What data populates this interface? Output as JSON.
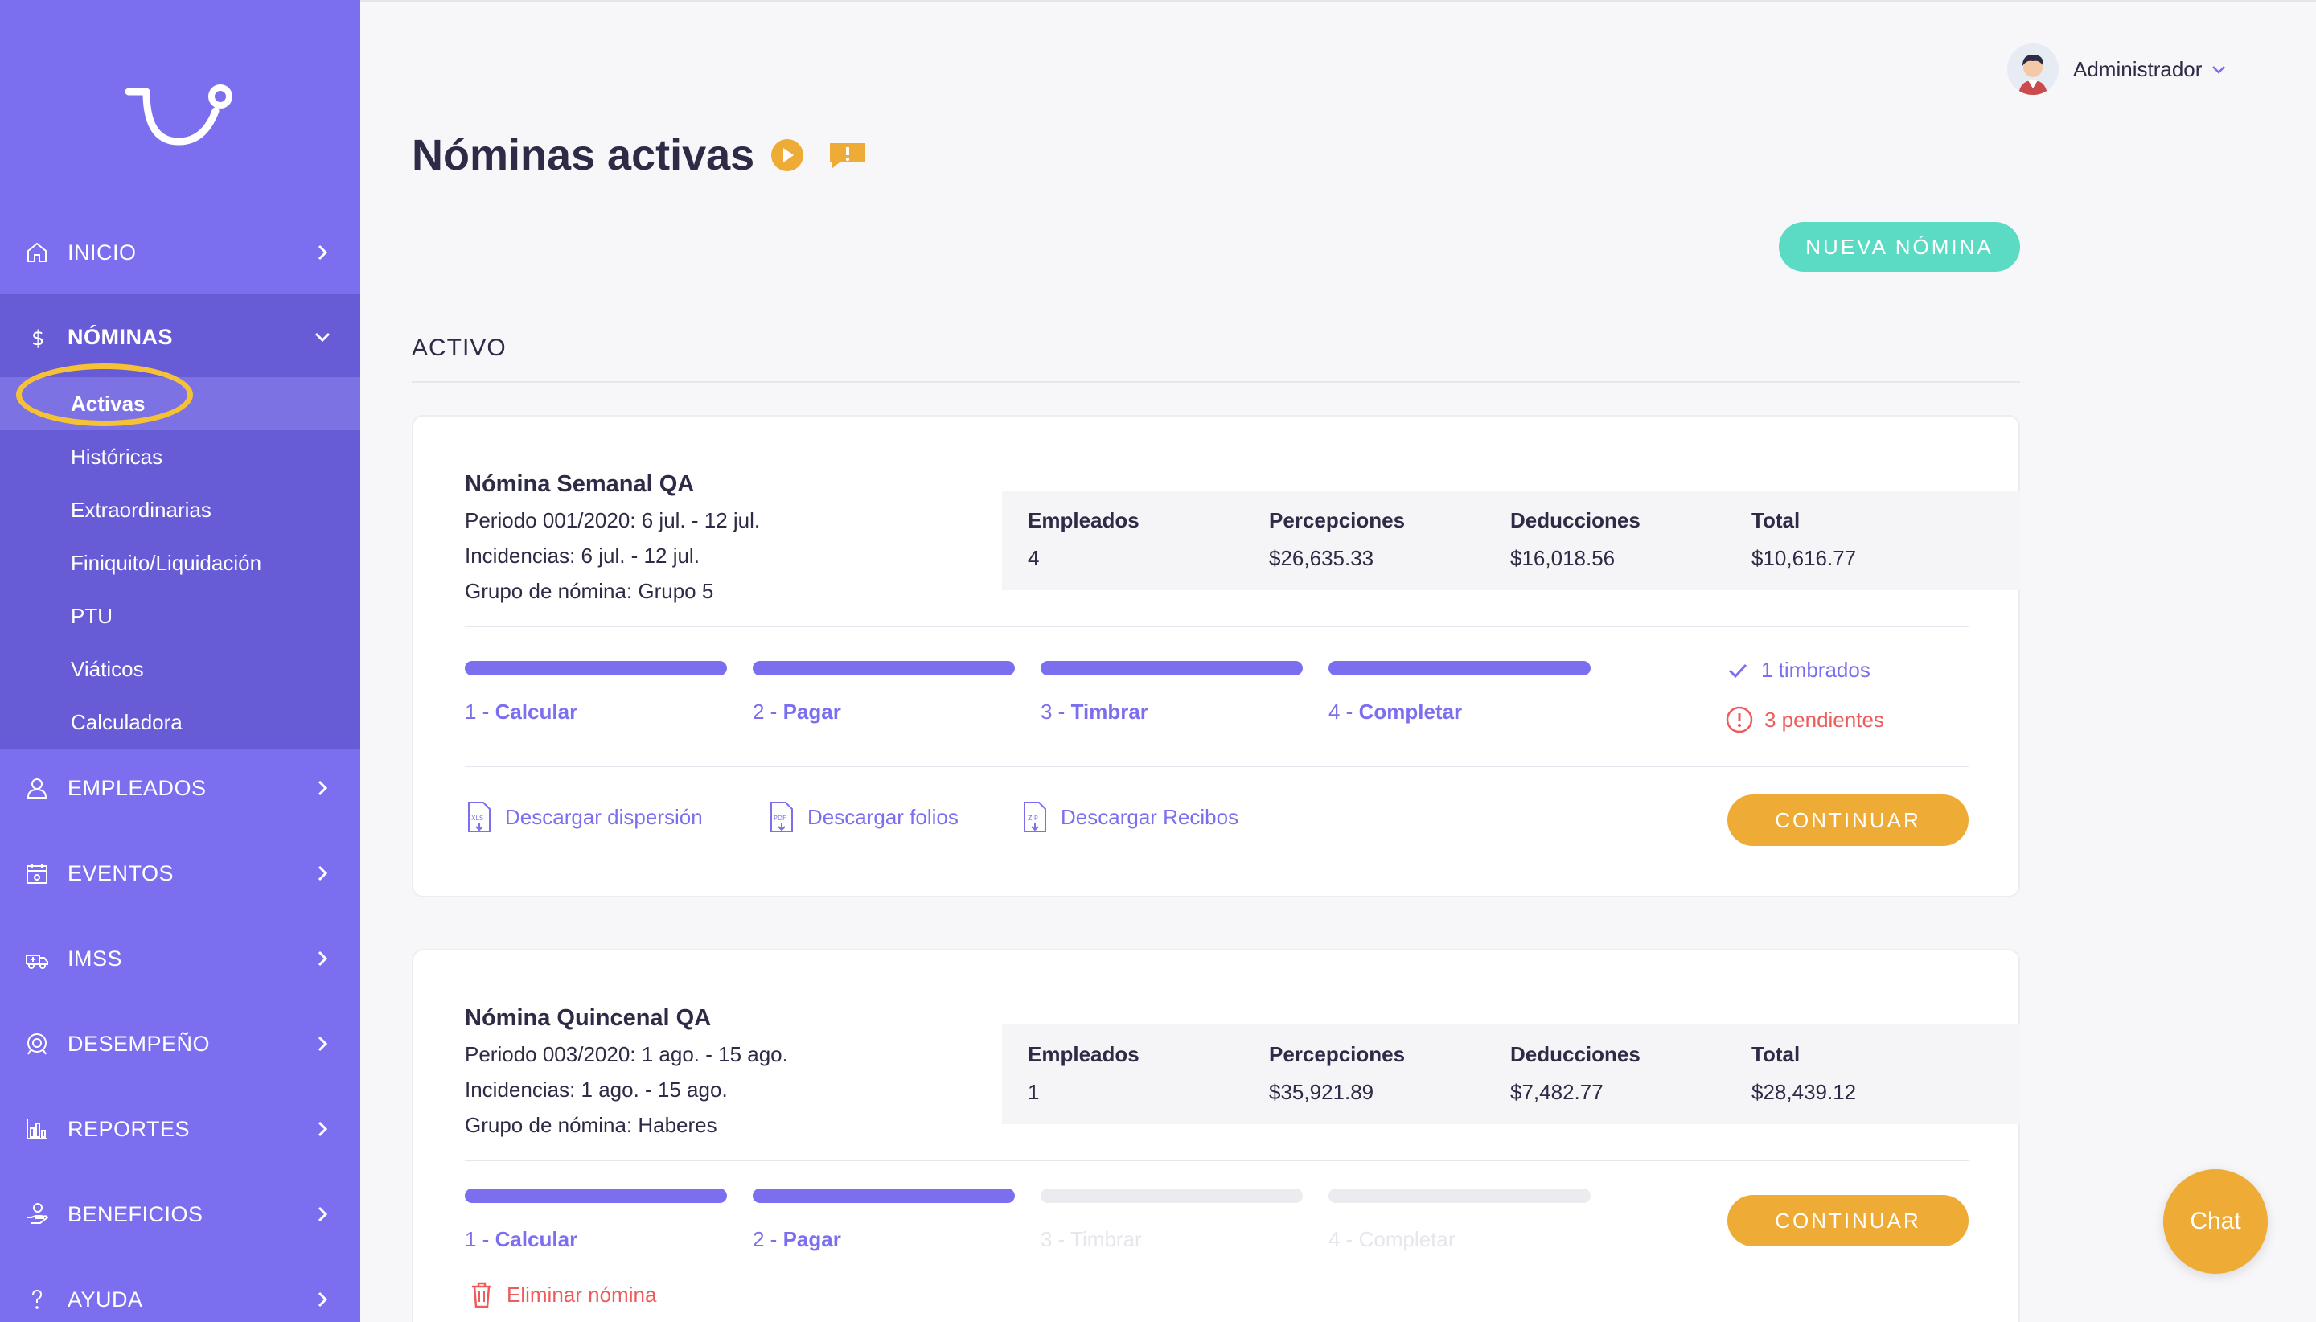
{
  "sidebar": {
    "items": [
      {
        "label": "INICIO",
        "icon": "home-icon"
      },
      {
        "label": "NÓMINAS",
        "icon": "dollar-icon"
      },
      {
        "label": "EMPLEADOS",
        "icon": "user-icon"
      },
      {
        "label": "EVENTOS",
        "icon": "calendar-icon"
      },
      {
        "label": "IMSS",
        "icon": "ambulance-icon"
      },
      {
        "label": "DESEMPEÑO",
        "icon": "target-icon"
      },
      {
        "label": "REPORTES",
        "icon": "bar-chart-icon"
      },
      {
        "label": "BENEFICIOS",
        "icon": "hand-coin-icon"
      },
      {
        "label": "AYUDA",
        "icon": "question-icon"
      }
    ],
    "submenu": [
      "Activas",
      "Históricas",
      "Extraordinarias",
      "Finiquito/Liquidación",
      "PTU",
      "Viáticos",
      "Calculadora"
    ]
  },
  "header": {
    "user": "Administrador"
  },
  "main": {
    "title": "Nóminas activas",
    "new_button": "NUEVA NÓMINA",
    "section": "ACTIVO"
  },
  "cards": [
    {
      "title": "Nómina Semanal QA",
      "periodo": "Periodo 001/2020: 6 jul. - 12 jul.",
      "incidencias": "Incidencias: 6 jul. - 12 jul.",
      "grupo": "Grupo de nómina: Grupo 5",
      "stats": [
        {
          "label": "Empleados",
          "value": "4"
        },
        {
          "label": "Percepciones",
          "value": "$26,635.33"
        },
        {
          "label": "Deducciones",
          "value": "$16,018.56"
        },
        {
          "label": "Total",
          "value": "$10,616.77"
        }
      ],
      "steps": [
        {
          "num": "1 - ",
          "name": "Calcular",
          "done": true
        },
        {
          "num": "2 - ",
          "name": "Pagar",
          "done": true
        },
        {
          "num": "3 - ",
          "name": "Timbrar",
          "done": true
        },
        {
          "num": "4 - ",
          "name": "Completar",
          "done": true
        }
      ],
      "timbrados": "1 timbrados",
      "pendientes": "3 pendientes",
      "downloads": [
        "Descargar dispersión",
        "Descargar folios",
        "Descargar Recibos"
      ],
      "continue_label": "CONTINUAR"
    },
    {
      "title": "Nómina Quincenal QA",
      "periodo": "Periodo 003/2020: 1 ago. - 15 ago.",
      "incidencias": "Incidencias: 1 ago. - 15 ago.",
      "grupo": "Grupo de nómina: Haberes",
      "stats": [
        {
          "label": "Empleados",
          "value": "1"
        },
        {
          "label": "Percepciones",
          "value": "$35,921.89"
        },
        {
          "label": "Deducciones",
          "value": "$7,482.77"
        },
        {
          "label": "Total",
          "value": "$28,439.12"
        }
      ],
      "steps": [
        {
          "num": "1 - ",
          "name": "Calcular",
          "done": true
        },
        {
          "num": "2 - ",
          "name": "Pagar",
          "done": true
        },
        {
          "num": "3 - ",
          "name": "Timbrar",
          "done": false
        },
        {
          "num": "4 - ",
          "name": "Completar",
          "done": false
        }
      ],
      "delete_label": "Eliminar nómina",
      "continue_label": "CONTINUAR"
    }
  ],
  "chat": {
    "label": "Chat"
  },
  "colors": {
    "sidebar": "#7b6ff0",
    "sidebar_active": "#675bd6",
    "accent": "#7b6ff0",
    "teal_button": "#5cdbc4",
    "orange_button": "#eeab36",
    "warning": "#ef5a5a",
    "highlight_ring": "#f6c235"
  }
}
